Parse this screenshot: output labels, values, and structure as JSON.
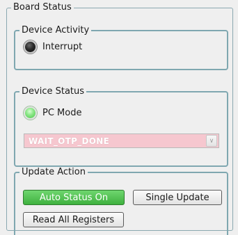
{
  "board_status": {
    "title": "Board Status",
    "device_activity": {
      "title": "Device Activity",
      "interrupt_label": "Interrupt",
      "interrupt_state": "off"
    },
    "device_status": {
      "title": "Device Status",
      "pc_mode_label": "PC Mode",
      "pc_mode_state": "on",
      "state_value": "WAIT_OTP_DONE",
      "state_color": "#f6c7cf"
    },
    "update_action": {
      "title": "Update Action",
      "auto_status_label": "Auto Status On",
      "auto_status_color": "#4cbc4c",
      "single_update_label": "Single Update",
      "read_all_label": "Read All Registers"
    }
  }
}
